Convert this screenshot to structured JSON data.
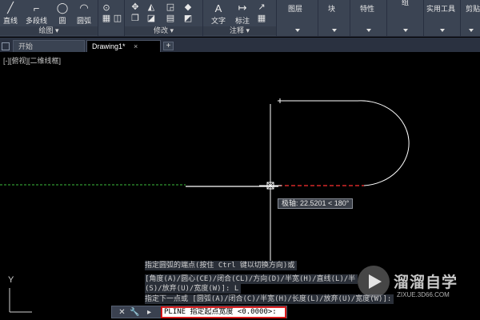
{
  "ribbon": {
    "draw_panel": {
      "title": "绘图",
      "tools": [
        {
          "label": "直线",
          "icon": "line-icon"
        },
        {
          "label": "多段线",
          "icon": "polyline-icon"
        },
        {
          "label": "圆",
          "icon": "circle-icon"
        },
        {
          "label": "圆弧",
          "icon": "arc-icon"
        }
      ]
    },
    "modify_panel": {
      "title": "修改"
    },
    "annotation_panel": {
      "title": "注释",
      "tools": [
        {
          "label": "文字",
          "icon": "text-icon"
        },
        {
          "label": "标注",
          "icon": "dimension-icon"
        }
      ]
    },
    "big_panels": [
      {
        "label": "图层",
        "icon": "layer-icon"
      },
      {
        "label": "块",
        "icon": "block-icon"
      },
      {
        "label": "特性",
        "icon": "properties-icon"
      },
      {
        "label": "组",
        "icon": "group-icon"
      },
      {
        "label": "实用工具",
        "icon": "utilities-icon"
      },
      {
        "label": "剪贴",
        "icon": "clipboard-icon"
      }
    ]
  },
  "tabs": [
    {
      "label": "开始",
      "active": false
    },
    {
      "label": "Drawing1*",
      "active": true
    }
  ],
  "tab_close": "×",
  "tab_add": "+",
  "viewport": {
    "label": "[-][俯视][二维线框]",
    "ucs_y_label": "Y"
  },
  "tooltip": {
    "text": "极轴: 22.5201 < 180°"
  },
  "command_history": [
    "指定圆弧的端点(按住 Ctrl 键以切换方向)或",
    "[角度(A)/圆心(CE)/闭合(CL)/方向(D)/半宽(H)/直线(L)/半",
    "(S)/放弃(U)/宽度(W)]: L",
    "指定下一点或 [圆弧(A)/闭合(C)/半宽(H)/长度(L)/放弃(U)/宽度(W)]:"
  ],
  "command_line": {
    "input_text": "PLINE 指定起点宽度 <0.0000>:",
    "close_glyph": "✕",
    "wrench_glyph": "🔧",
    "prompt_glyph": "▸"
  },
  "watermark": {
    "name": "溜溜自学",
    "url": "ZIXUE.3D66.COM"
  },
  "colors": {
    "ribbon_bg": "#3b4453",
    "viewport_bg": "#000000",
    "polyline": "#ffffff",
    "tracking_line": "#3cbd3c",
    "rubber_band": "#ff3030",
    "input_border": "#e03030"
  }
}
